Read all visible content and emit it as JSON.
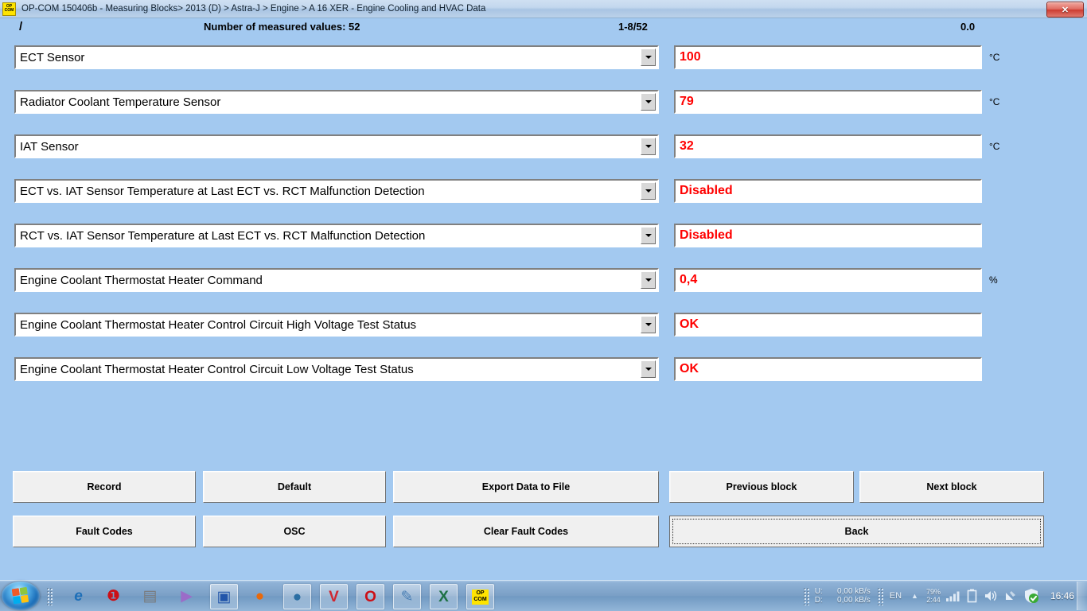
{
  "window": {
    "icon_label_top": "OP",
    "icon_label_bottom": "COM",
    "title": "OP-COM 150406b - Measuring Blocks> 2013 (D) > Astra-J > Engine > A 16 XER - Engine Cooling and HVAC Data",
    "close_label": "✕"
  },
  "header": {
    "slash": "/",
    "measured_values": "Number of measured values: 52",
    "range": "1-8/52",
    "elapsed": "0.0"
  },
  "rows": [
    {
      "name": "ECT Sensor",
      "value": "100",
      "unit": "°C"
    },
    {
      "name": "Radiator Coolant Temperature Sensor",
      "value": "79",
      "unit": "°C"
    },
    {
      "name": "IAT Sensor",
      "value": "32",
      "unit": "°C"
    },
    {
      "name": "ECT vs. IAT Sensor Temperature at Last ECT vs. RCT Malfunction Detection",
      "value": "Disabled",
      "unit": ""
    },
    {
      "name": "RCT vs. IAT Sensor Temperature at Last ECT vs. RCT Malfunction Detection",
      "value": "Disabled",
      "unit": ""
    },
    {
      "name": "Engine Coolant Thermostat Heater Command",
      "value": "0,4",
      "unit": "%"
    },
    {
      "name": "Engine Coolant Thermostat Heater Control Circuit High Voltage Test Status",
      "value": "OK",
      "unit": ""
    },
    {
      "name": "Engine Coolant Thermostat Heater Control Circuit Low Voltage Test Status",
      "value": "OK",
      "unit": ""
    }
  ],
  "buttons": {
    "record": "Record",
    "default": "Default",
    "export": "Export Data to File",
    "previous_block": "Previous block",
    "next_block": "Next block",
    "fault_codes": "Fault Codes",
    "osc": "OSC",
    "clear_fault_codes": "Clear Fault Codes",
    "back": "Back"
  },
  "taskbar": {
    "icons": [
      {
        "name": "internet-explorer-icon",
        "glyph": "e",
        "framed": false,
        "color": "#1e6fb8"
      },
      {
        "name": "opera-legacy-icon",
        "glyph": "▌",
        "framed": false,
        "color": "#cc0f16"
      },
      {
        "name": "notes-app-icon",
        "glyph": "▤",
        "framed": false,
        "color": "#6a6a6a"
      },
      {
        "name": "media-player-icon",
        "glyph": "▶",
        "framed": false,
        "color": "#9b6cc8"
      },
      {
        "name": "save-floppy-icon",
        "glyph": "▣",
        "framed": true,
        "color": "#2255aa"
      },
      {
        "name": "firefox-icon",
        "glyph": "●",
        "framed": false,
        "color": "#e8690b"
      },
      {
        "name": "thunderbird-icon",
        "glyph": "●",
        "framed": true,
        "color": "#2b6ea3"
      },
      {
        "name": "vivaldi-icon",
        "glyph": "V",
        "framed": true,
        "color": "#cf2731"
      },
      {
        "name": "opera-icon",
        "glyph": "O",
        "framed": true,
        "color": "#cc0f16"
      },
      {
        "name": "paint-icon",
        "glyph": "✎",
        "framed": true,
        "color": "#4a7fb5"
      },
      {
        "name": "excel-icon",
        "glyph": "X",
        "framed": true,
        "color": "#1e7145"
      },
      {
        "name": "opcom-icon",
        "glyph": "OP",
        "framed": true,
        "color": "#000000"
      }
    ],
    "tray": {
      "upload_label": "U:",
      "upload_value": "0,00 kB/s",
      "download_label": "D:",
      "download_value": "0,00 kB/s",
      "language": "EN",
      "battery_percent": "79%",
      "battery_time": "2:44",
      "clock": "16:46"
    }
  }
}
